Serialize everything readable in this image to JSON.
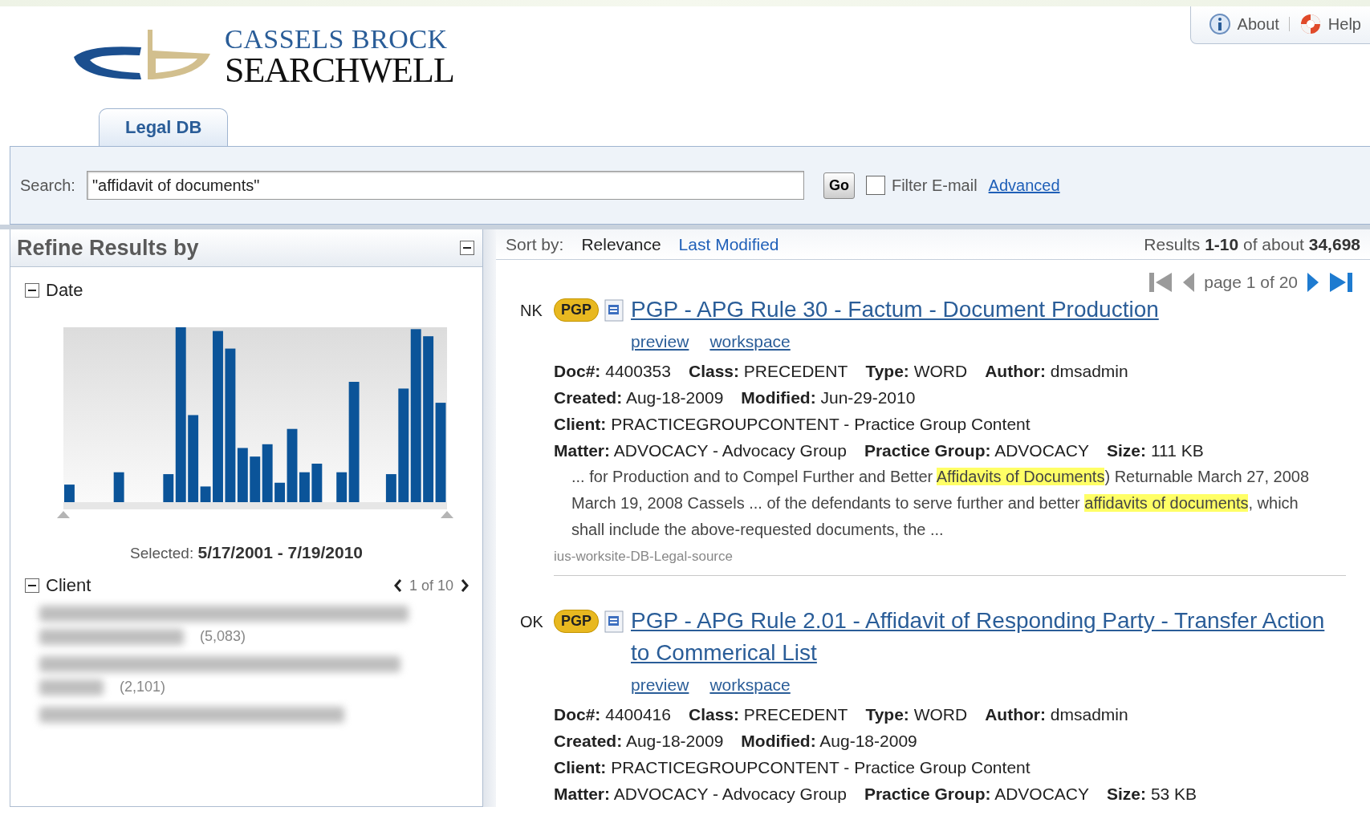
{
  "header": {
    "brand_top": "CASSELS BROCK",
    "brand_bottom": "SEARCHWELL",
    "links": [
      {
        "kind": "info",
        "label": "About"
      },
      {
        "kind": "help",
        "label": "Help"
      }
    ]
  },
  "tabs": [
    {
      "label": "Legal DB",
      "selected": true
    }
  ],
  "search": {
    "label": "Search:",
    "value": "\"affidavit of documents\"",
    "button": "Go",
    "filter": {
      "label": "Filter E-mail",
      "checked": false
    },
    "advanced": "Advanced"
  },
  "refine": {
    "title": "Refine Results by",
    "date": {
      "title": "Date",
      "expanded": true,
      "selected_label": "Selected:",
      "selected_range": "5/17/2001 - 7/19/2010"
    },
    "client": {
      "title": "Client",
      "expanded": true,
      "pager": "1 of 10",
      "counts": [
        "(5,083)",
        "(2,101)"
      ]
    }
  },
  "sort": {
    "label": "Sort by:",
    "options": [
      {
        "label": "Relevance",
        "selected": true
      },
      {
        "label": "Last Modified",
        "selected": false
      }
    ],
    "summary": "Results **1-10** of about **34,698**"
  },
  "pager": {
    "text": "page 1 of 20"
  },
  "results": [
    {
      "initials": "NK",
      "badge": "PGP",
      "title": "PGP - APG Rule 30 - Factum - Document Production",
      "links": [
        "preview",
        "workspace"
      ],
      "meta": [
        [
          {
            "label": "Doc#:",
            "value": "4400353"
          },
          {
            "label": "Class:",
            "value": "PRECEDENT"
          },
          {
            "label": "Type:",
            "value": "WORD"
          },
          {
            "label": "Author:",
            "value": "dmsadmin"
          }
        ],
        [
          {
            "label": "Created:",
            "value": "Aug-18-2009"
          },
          {
            "label": "Modified:",
            "value": "Jun-29-2010"
          }
        ],
        [
          {
            "label": "Client:",
            "value": "PRACTICEGROUPCONTENT - Practice Group Content"
          }
        ],
        [
          {
            "label": "Matter:",
            "value": "ADVOCACY - Advocacy Group"
          },
          {
            "label": "Practice Group:",
            "value": "ADVOCACY"
          },
          {
            "label": "Size:",
            "value": "111 KB"
          }
        ]
      ],
      "snippet": [
        {
          "text": "... for Production and to Compel Further and Better ",
          "highlight": false
        },
        {
          "text": "Affidavits of Documents",
          "highlight": true
        },
        {
          "text": ") Returnable March 27, 2008 March 19, 2008 Cassels ... of the defendants to serve further and better ",
          "highlight": false
        },
        {
          "text": "affidavits of documents",
          "highlight": true
        },
        {
          "text": ", which shall include the above-requested documents, the ...",
          "highlight": false
        }
      ],
      "source": "ius-worksite-DB-Legal-source"
    },
    {
      "initials": "OK",
      "badge": "PGP",
      "title": "PGP - APG Rule 2.01 - Affidavit of Responding Party - Transfer Action to Commerical List",
      "links": [
        "preview",
        "workspace"
      ],
      "meta": [
        [
          {
            "label": "Doc#:",
            "value": "4400416"
          },
          {
            "label": "Class:",
            "value": "PRECEDENT"
          },
          {
            "label": "Type:",
            "value": "WORD"
          },
          {
            "label": "Author:",
            "value": "dmsadmin"
          }
        ],
        [
          {
            "label": "Created:",
            "value": "Aug-18-2009"
          },
          {
            "label": "Modified:",
            "value": "Aug-18-2009"
          }
        ],
        [
          {
            "label": "Client:",
            "value": "PRACTICEGROUPCONTENT - Practice Group Content"
          }
        ],
        [
          {
            "label": "Matter:",
            "value": "ADVOCACY - Advocacy Group"
          },
          {
            "label": "Practice Group:",
            "value": "ADVOCACY"
          },
          {
            "label": "Size:",
            "value": "53 KB"
          }
        ]
      ]
    }
  ]
}
